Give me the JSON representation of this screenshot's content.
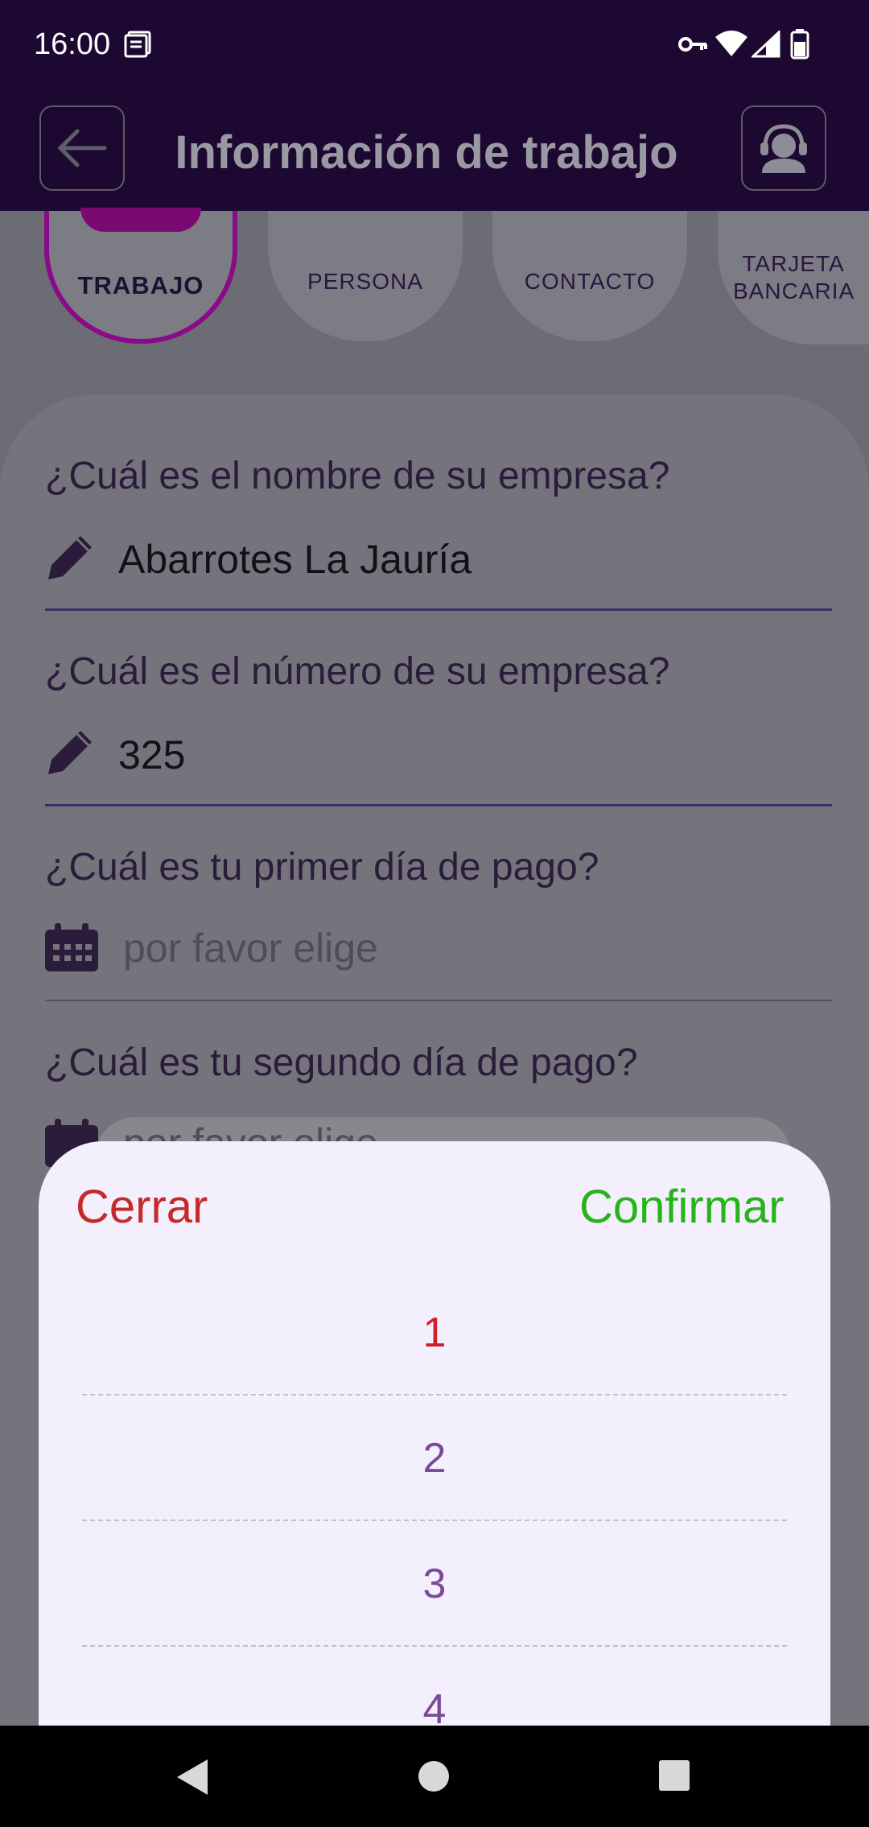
{
  "status_bar": {
    "time": "16:00"
  },
  "app_bar": {
    "title": "Información de trabajo"
  },
  "steps": [
    {
      "label": "TRABAJO"
    },
    {
      "label": "PERSONA"
    },
    {
      "label": "CONTACTO"
    },
    {
      "label": "TARJETA BANCARIA"
    }
  ],
  "form": {
    "company_name": {
      "label": "¿Cuál es el nombre de su empresa?",
      "value": "Abarrotes La Jauría"
    },
    "company_number": {
      "label": "¿Cuál es el número de su empresa?",
      "value": "325"
    },
    "first_payday": {
      "label": "¿Cuál es tu primer día de pago?",
      "placeholder": "por favor elige"
    },
    "second_payday": {
      "label": "¿Cuál es tu segundo día de pago?",
      "placeholder": "por favor elige"
    }
  },
  "picker": {
    "close_label": "Cerrar",
    "confirm_label": "Confirmar",
    "options": [
      "1",
      "2",
      "3",
      "4"
    ],
    "selected": "1"
  },
  "colors": {
    "app_bar": "#1c0830",
    "accent_step": "#8a0a8a",
    "close": "#c5292a",
    "confirm": "#27b31a",
    "selected_option": "#cc1f2a",
    "option": "#7a4a98"
  },
  "icons": {
    "back": "arrow-left-icon",
    "support": "headset-agent-icon",
    "edit": "pencil-icon",
    "calendar": "calendar-icon"
  }
}
